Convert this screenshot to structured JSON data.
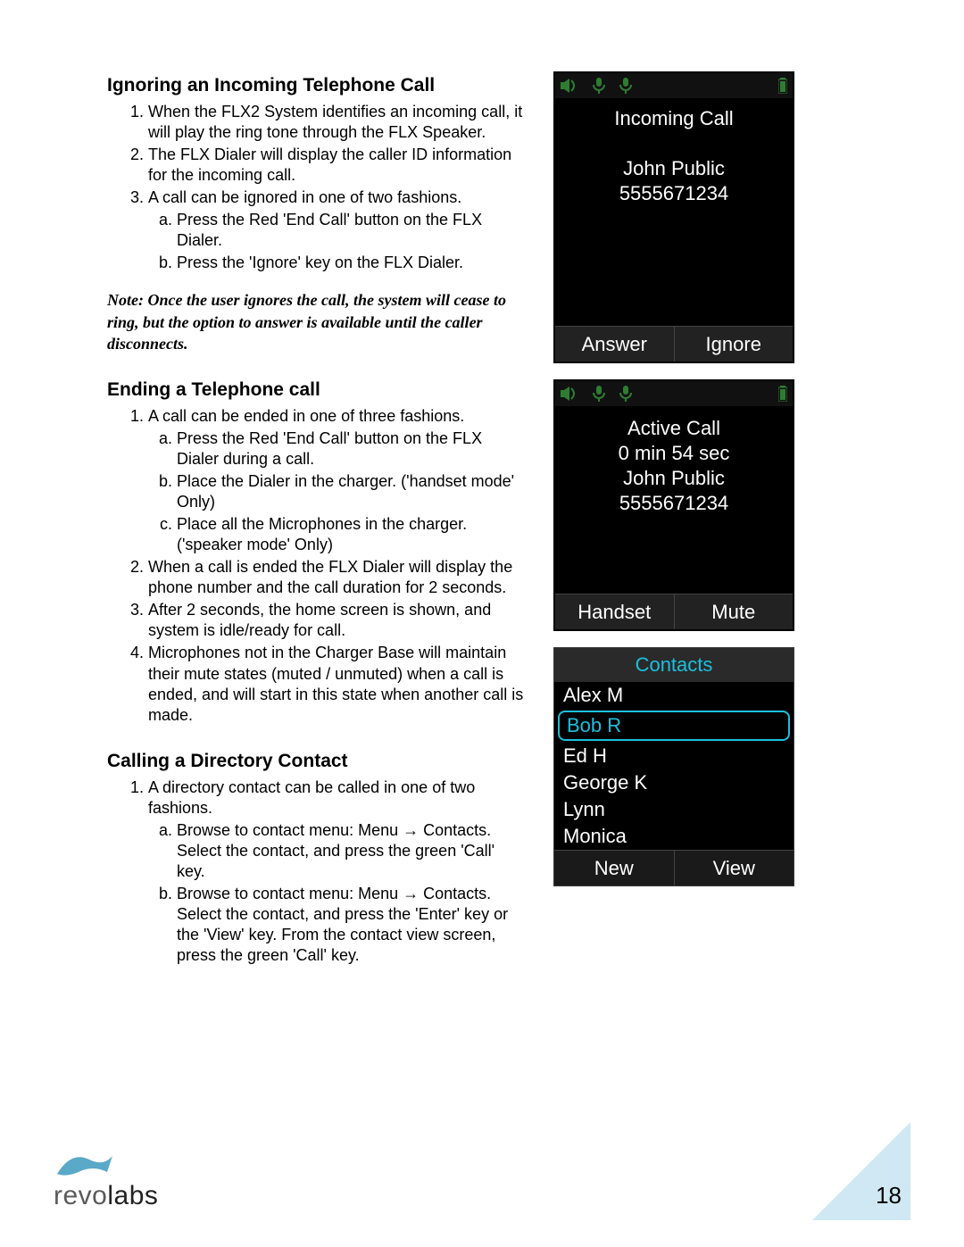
{
  "sections": {
    "ignore": {
      "heading": "Ignoring an Incoming Telephone Call",
      "items": [
        "When the FLX2 System identifies an incoming call, it will play the ring tone through the FLX Speaker.",
        "The FLX Dialer will display the caller ID information for the incoming call.",
        "A call can be ignored in one of two fashions."
      ],
      "sub_a": "Press the Red 'End Call' button on the FLX Dialer.",
      "sub_b": "Press the 'Ignore' key on the FLX Dialer."
    },
    "note": "Note: Once the user ignores the call, the system will cease to ring, but the option to answer is available until the caller disconnects.",
    "ending": {
      "heading": "Ending a Telephone call",
      "item1": "A call can be ended in one of three fashions.",
      "sub_a": "Press the Red 'End Call' button on the FLX Dialer during a call.",
      "sub_b": "Place the Dialer in the charger. ('handset mode' Only)",
      "sub_c": "Place all the Microphones in the charger. ('speaker mode' Only)",
      "item2": "When a call is ended the FLX Dialer will display the phone number and the call duration for 2 seconds.",
      "item3": "After 2 seconds, the home screen is shown, and system is idle/ready for call.",
      "item4": "Microphones not in the Charger Base will maintain their mute states (muted / unmuted) when a call is ended, and will start in this state when another call is made."
    },
    "calling": {
      "heading": "Calling a Directory Contact",
      "item1": "A directory contact can be called in one of two fashions.",
      "sub_a": "Browse to contact menu: Menu → Contacts. Select the contact, and press the green 'Call' key.",
      "sub_b": "Browse to contact menu: Menu → Contacts. Select the contact, and press the 'Enter' key or the 'View' key. From the contact view screen, press the green 'Call' key."
    }
  },
  "screens": {
    "incoming": {
      "title": "Incoming Call",
      "name": "John Public",
      "number": "5555671234",
      "sk_left": "Answer",
      "sk_right": "Ignore"
    },
    "active": {
      "title": "Active Call",
      "duration": "0 min 54 sec",
      "name": "John Public",
      "number": "5555671234",
      "sk_left": "Handset",
      "sk_right": "Mute"
    },
    "contacts": {
      "title": "Contacts",
      "items": [
        "Alex M",
        "Bob R",
        "Ed H",
        "George K",
        "Lynn",
        "Monica"
      ],
      "selected_index": 1,
      "sk_left": "New",
      "sk_right": "View"
    }
  },
  "footer": {
    "brand_a": "revo",
    "brand_b": "labs",
    "page": "18"
  }
}
